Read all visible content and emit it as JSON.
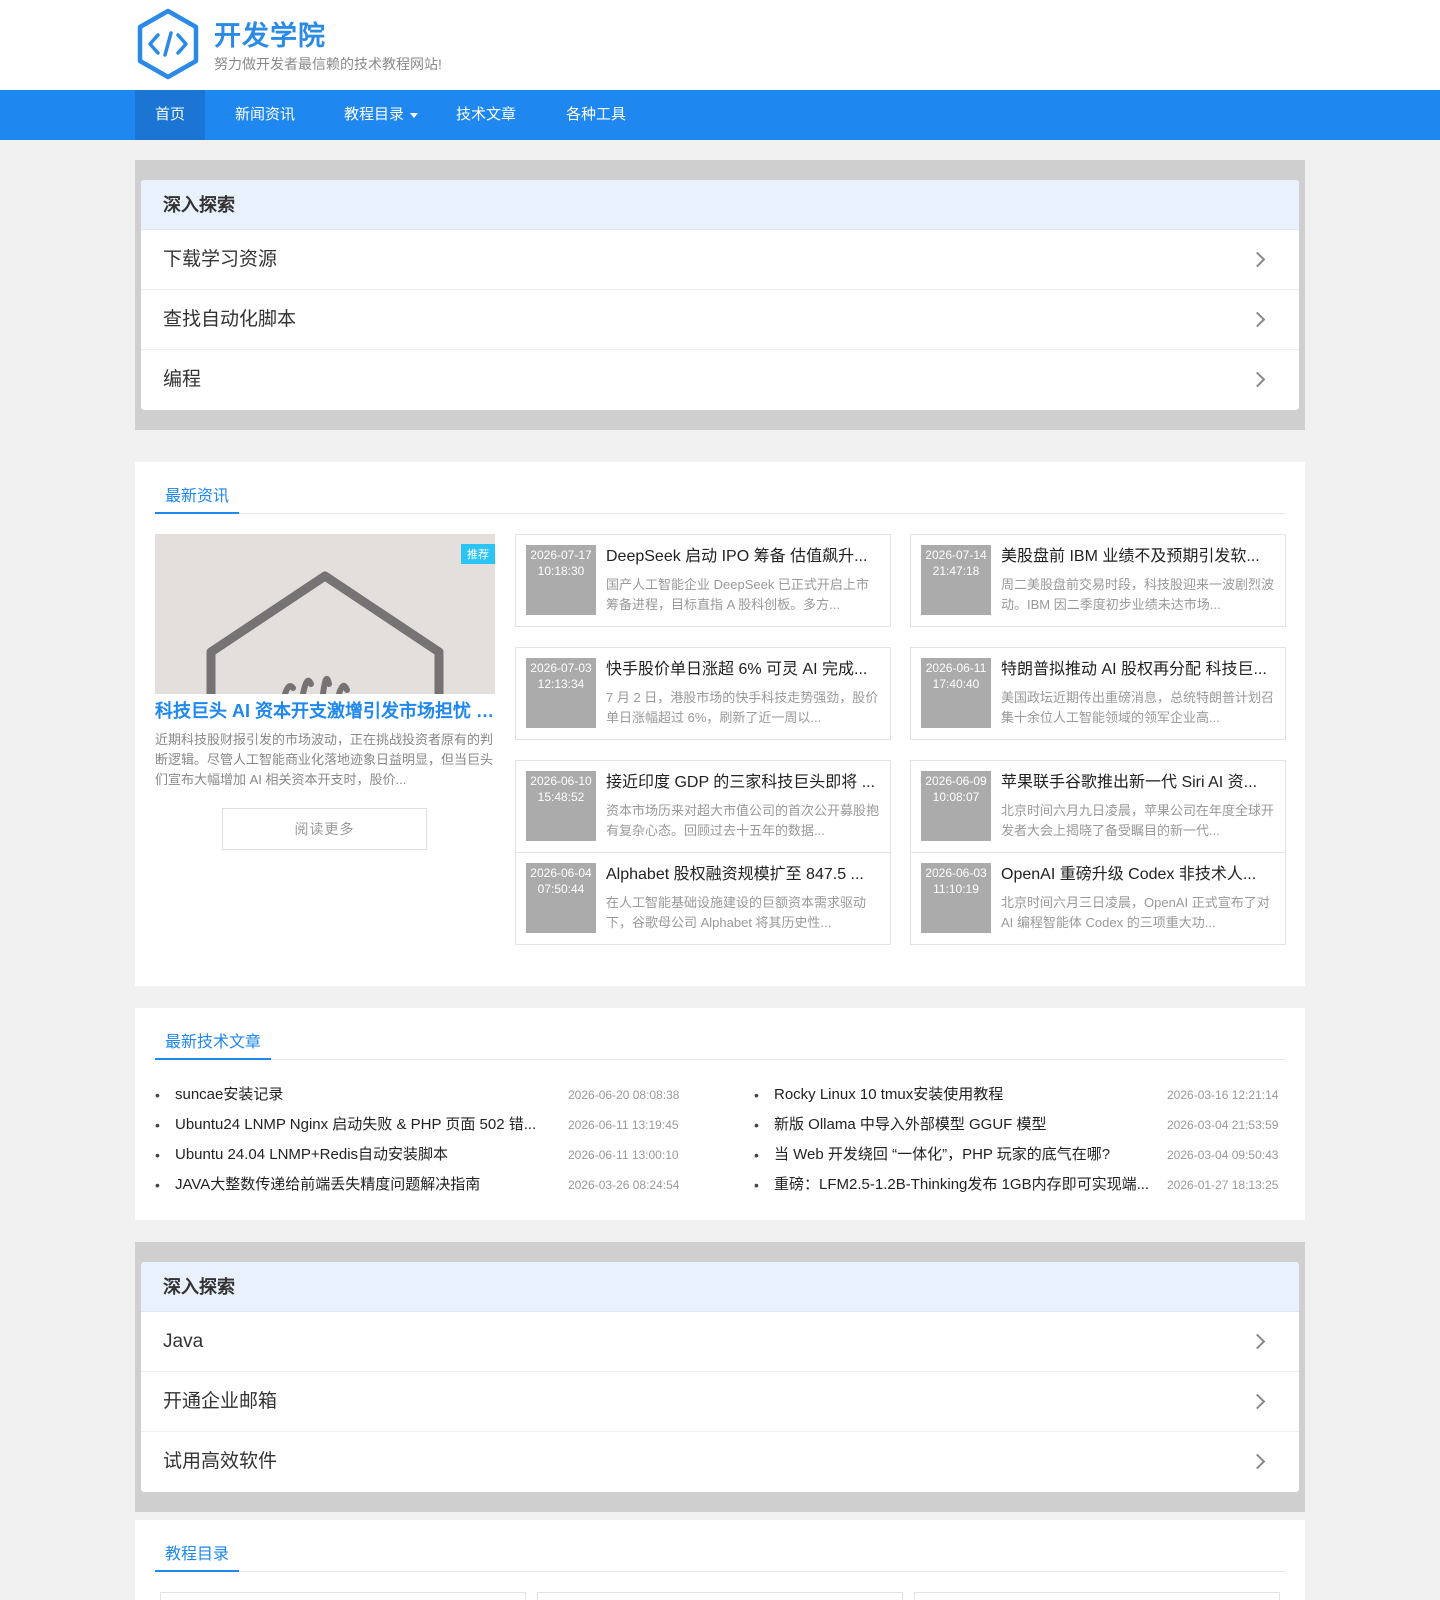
{
  "site": {
    "name": "开发学院",
    "slogan": "努力做开发者最信赖的技术教程网站!"
  },
  "nav": {
    "items": [
      {
        "label": "首页"
      },
      {
        "label": "新闻资讯"
      },
      {
        "label": "教程目录"
      },
      {
        "label": "技术文章"
      },
      {
        "label": "各种工具"
      }
    ]
  },
  "explore1": {
    "title": "深入探索",
    "items": [
      "下载学习资源",
      "查找自动化脚本",
      "编程"
    ]
  },
  "news": {
    "title": "最新资讯",
    "featured": {
      "badge": "推荐",
      "title": "科技巨头 AI 资本开支激增引发市场担忧 盈利...",
      "desc": "近期科技股财报引发的市场波动，正在挑战投资者原有的判断逻辑。尽管人工智能商业化落地迹象日益明显，但当巨头们宣布大幅增加 AI 相关资本开支时，股价...",
      "read_more": "阅读更多"
    },
    "items": [
      {
        "date": "2026-07-17",
        "time": "10:18:30",
        "title": "DeepSeek 启动 IPO 筹备 估值飙升...",
        "desc": "国产人工智能企业 DeepSeek 已正式开启上市筹备进程，目标直指 A 股科创板。多方..."
      },
      {
        "date": "2026-07-14",
        "time": "21:47:18",
        "title": "美股盘前 IBM 业绩不及预期引发软...",
        "desc": "周二美股盘前交易时段，科技股迎来一波剧烈波动。IBM 因二季度初步业绩未达市场..."
      },
      {
        "date": "2026-07-03",
        "time": "12:13:34",
        "title": "快手股价单日涨超 6% 可灵 AI 完成...",
        "desc": "7 月 2 日，港股市场的快手科技走势强劲，股价单日涨幅超过 6%，刷新了近一周以..."
      },
      {
        "date": "2026-06-11",
        "time": "17:40:40",
        "title": "特朗普拟推动 AI 股权再分配 科技巨...",
        "desc": "美国政坛近期传出重磅消息，总统特朗普计划召集十余位人工智能领域的领军企业高..."
      },
      {
        "date": "2026-06-10",
        "time": "15:48:52",
        "title": "接近印度 GDP 的三家科技巨头即将 ...",
        "desc": "资本市场历来对超大市值公司的首次公开募股抱有复杂心态。回顾过去十五年的数据..."
      },
      {
        "date": "2026-06-09",
        "time": "10:08:07",
        "title": "苹果联手谷歌推出新一代 Siri AI 资...",
        "desc": "北京时间六月九日凌晨，苹果公司在年度全球开发者大会上揭晓了备受瞩目的新一代..."
      },
      {
        "date": "2026-06-04",
        "time": "07:50:44",
        "title": "Alphabet 股权融资规模扩至 847.5 ...",
        "desc": "在人工智能基础设施建设的巨额资本需求驱动下，谷歌母公司 Alphabet 将其历史性..."
      },
      {
        "date": "2026-06-03",
        "time": "11:10:19",
        "title": "OpenAI 重磅升级 Codex 非技术人...",
        "desc": "北京时间六月三日凌晨，OpenAI 正式宣布了对 AI 编程智能体 Codex 的三项重大功..."
      }
    ]
  },
  "articles": {
    "title": "最新技术文章",
    "bullet": "•",
    "left": [
      {
        "title": "suncae安装记录",
        "date": "2026-06-20 08:08:38"
      },
      {
        "title": "Ubuntu24 LNMP Nginx 启动失败 & PHP 页面 502 错...",
        "date": "2026-06-11 13:19:45"
      },
      {
        "title": "Ubuntu 24.04 LNMP+Redis自动安装脚本",
        "date": "2026-06-11 13:00:10"
      },
      {
        "title": "JAVA大整数传递给前端丢失精度问题解决指南",
        "date": "2026-03-26 08:24:54"
      }
    ],
    "right": [
      {
        "title": "Rocky Linux 10 tmux安装使用教程",
        "date": "2026-03-16 12:21:14"
      },
      {
        "title": "新版 Ollama 中导入外部模型 GGUF 模型",
        "date": "2026-03-04 21:53:59"
      },
      {
        "title": "当 Web 开发绕回 “一体化”，PHP 玩家的底气在哪?",
        "date": "2026-03-04 09:50:43"
      },
      {
        "title": "重磅：LFM2.5-1.2B-Thinking发布 1GB内存即可实现端...",
        "date": "2026-01-27 18:13:25"
      }
    ]
  },
  "explore2": {
    "title": "深入探索",
    "items": [
      "Java",
      "开通企业邮箱",
      "试用高效软件"
    ]
  },
  "tutorials": {
    "title": "教程目录"
  },
  "colors": {
    "brand": "#1e87f0",
    "nav_active": "#1a76d2",
    "thumb": "#ababab",
    "badge": "#2bc4f5"
  },
  "icons": {
    "logo": "code-hexagon-icon",
    "dropdown": "caret-down-icon",
    "row": "chevron-right-icon"
  }
}
